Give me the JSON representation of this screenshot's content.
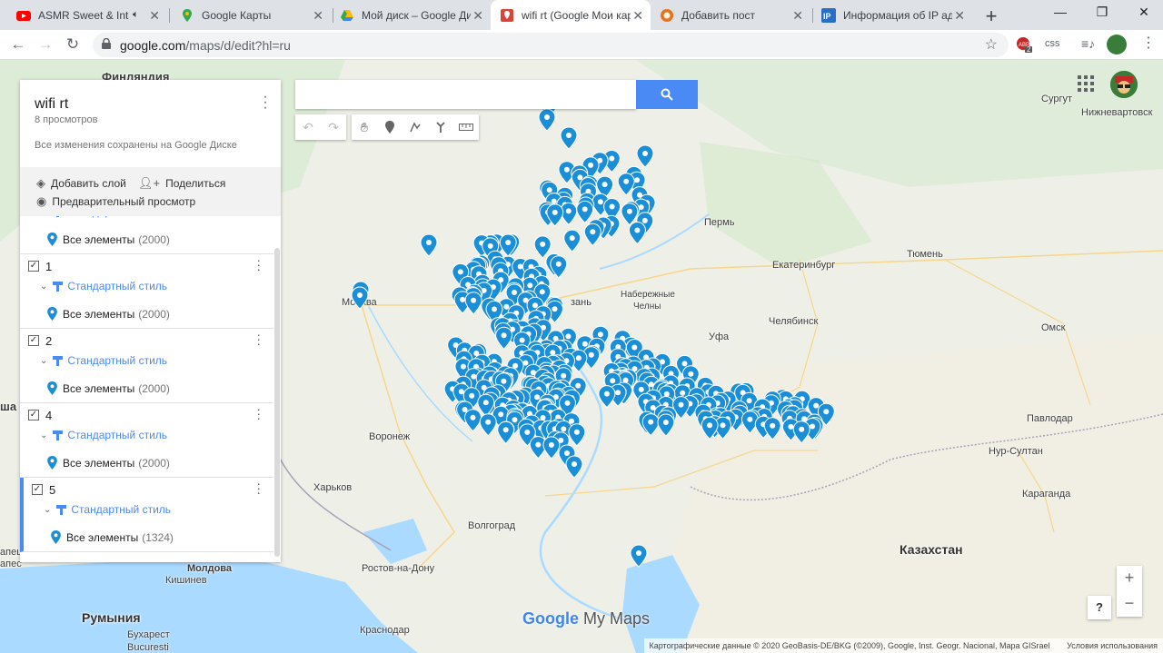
{
  "tabs": [
    {
      "title": "ASMR Sweet & Inte",
      "icon": "youtube-icon"
    },
    {
      "title": "Google Карты",
      "icon": "google-maps-icon"
    },
    {
      "title": "Мой диск – Google Ди",
      "icon": "google-drive-icon"
    },
    {
      "title": "wifi rt (Google Мои кар",
      "icon": "my-maps-icon"
    },
    {
      "title": "Добавить пост",
      "icon": "site-icon"
    },
    {
      "title": "Информация об IP адр",
      "icon": "ip-icon"
    }
  ],
  "browser": {
    "url_host": "google.com",
    "url_path": "/maps/d/edit?hl=ru",
    "ext_badge": "2",
    "ext_css": "css"
  },
  "panel": {
    "title": "wifi rt",
    "views": "8 просмотров",
    "saved": "Все изменения сохранены на Google Диске",
    "add_layer": "Добавить слой",
    "share": "Поделиться",
    "preview": "Предварительный просмотр",
    "partial_style": "Стандартный стиль",
    "partial_items": "Все элементы",
    "partial_count": "(2000)",
    "layers": [
      {
        "name": "1",
        "style": "Стандартный стиль",
        "items": "Все элементы",
        "count": "(2000)"
      },
      {
        "name": "2",
        "style": "Стандартный стиль",
        "items": "Все элементы",
        "count": "(2000)"
      },
      {
        "name": "4",
        "style": "Стандартный стиль",
        "items": "Все элементы",
        "count": "(2000)"
      },
      {
        "name": "5",
        "style": "Стандартный стиль",
        "items": "Все элементы",
        "count": "(1324)"
      }
    ]
  },
  "map": {
    "cities": [
      {
        "name": "Финляндия"
      },
      {
        "name": "Сургут"
      },
      {
        "name": "Нижневартовск"
      },
      {
        "name": "Пермь"
      },
      {
        "name": "Екатеринбург"
      },
      {
        "name": "Тюмень"
      },
      {
        "name": "Набережные"
      },
      {
        "name": "Челны"
      },
      {
        "name": "Челябинск"
      },
      {
        "name": "Уфа"
      },
      {
        "name": "Омск"
      },
      {
        "name": "Павлодар"
      },
      {
        "name": "Нур-Султан"
      },
      {
        "name": "Караганда"
      },
      {
        "name": "Воронеж"
      },
      {
        "name": "Харьков"
      },
      {
        "name": "Волгоград"
      },
      {
        "name": "Ростов-на-Дону"
      },
      {
        "name": "Краснодар"
      },
      {
        "name": "Молдова"
      },
      {
        "name": "Кишинев"
      },
      {
        "name": "Бухарест"
      },
      {
        "name": "Bucuresti"
      },
      {
        "name": "Мо"
      },
      {
        "name": "ква"
      },
      {
        "name": "зань"
      },
      {
        "name": "ша"
      },
      {
        "name": "апец"
      },
      {
        "name": "апес"
      }
    ],
    "countries": [
      {
        "name": "Казахстан"
      },
      {
        "name": "Румыния"
      }
    ],
    "logo_google": "Google",
    "logo_mymaps": "My Maps",
    "attribution": "Картографические данные © 2020 GeoBasis-DE/BKG (©2009), Google, Inst. Geogr. Nacional, Mapa GISrael",
    "terms": "Условия использования",
    "zoom_in": "+",
    "zoom_out": "−",
    "help": "?"
  },
  "colors": {
    "pin": "#1a8fd8",
    "accent": "#4a8af4",
    "map_bg": "#eef0e8",
    "water": "#aadaff",
    "forest": "#c8e6b0"
  }
}
